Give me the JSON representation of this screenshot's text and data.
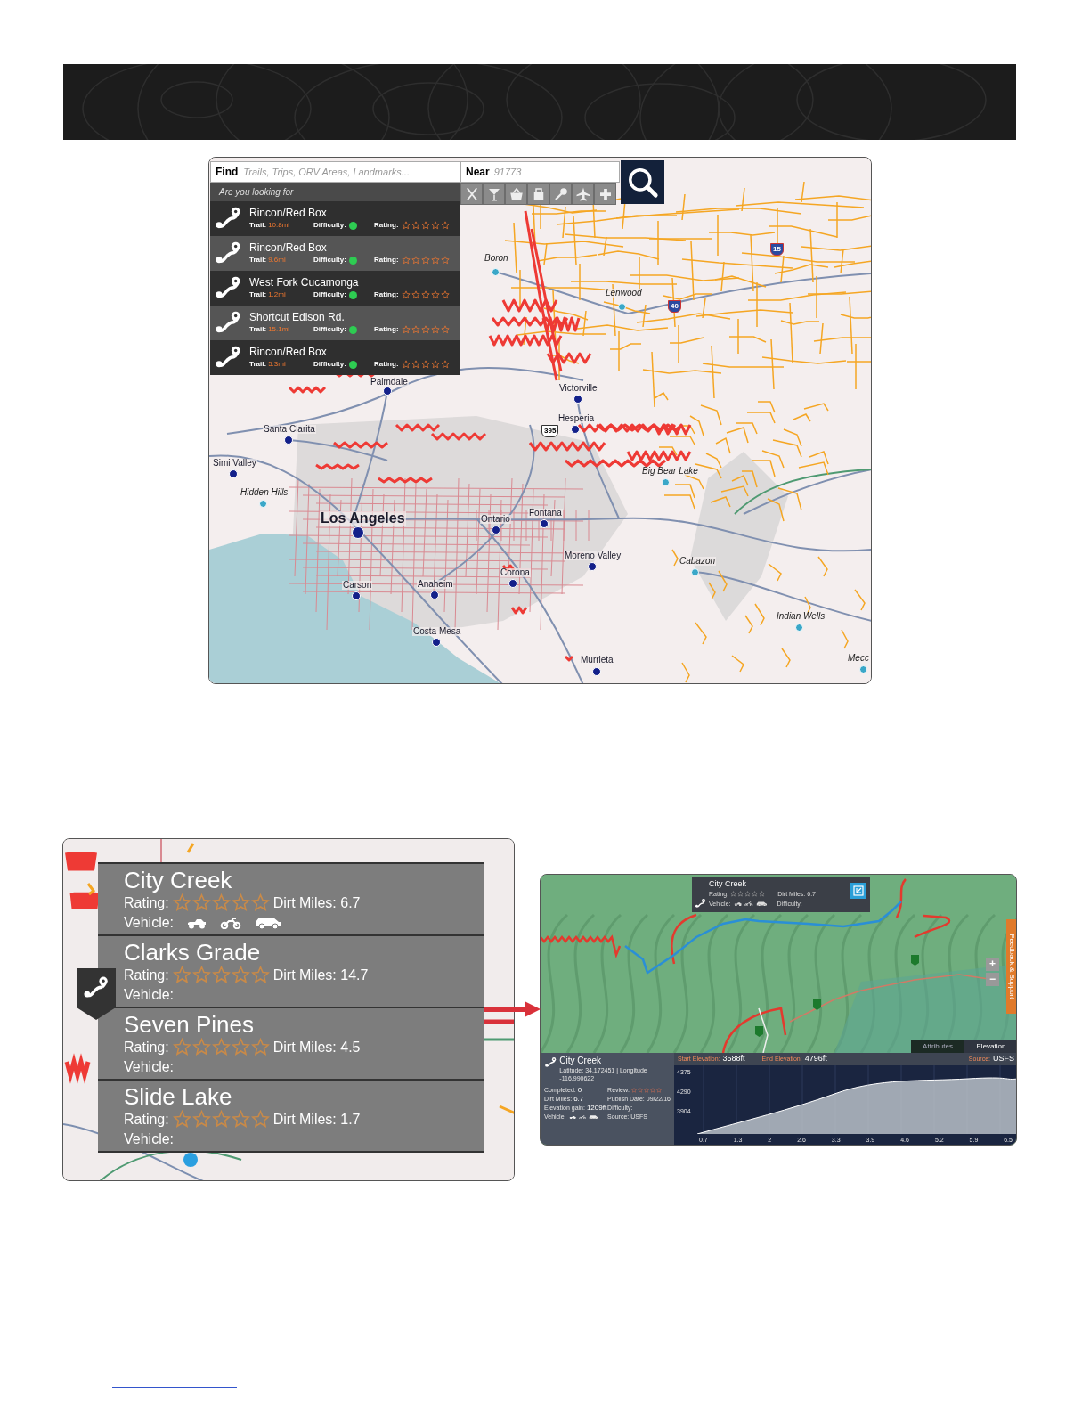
{
  "map_search": {
    "find": {
      "label": "Find",
      "placeholder": "Trails, Trips, ORV Areas, Landmarks..."
    },
    "near": {
      "label": "Near",
      "placeholder": "91773"
    },
    "suggestions": {
      "heading": "Are you looking for",
      "items": [
        {
          "name": "Rincon/Red Box",
          "trail_label": "Trail:",
          "length": "10.8mi",
          "difficulty_label": "Difficulty:",
          "color": "#2ecc52",
          "rating_label": "Rating:",
          "stars": 0
        },
        {
          "name": "Rincon/Red Box",
          "trail_label": "Trail:",
          "length": "9.6mi",
          "difficulty_label": "Difficulty:",
          "color": "#2ecc52",
          "rating_label": "Rating:",
          "stars": 0
        },
        {
          "name": "West Fork Cucamonga",
          "trail_label": "Trail:",
          "length": "1.2mi",
          "difficulty_label": "Difficulty:",
          "color": "#2ecc52",
          "rating_label": "Rating:",
          "stars": 0
        },
        {
          "name": "Shortcut Edison Rd.",
          "trail_label": "Trail:",
          "length": "15.1mi",
          "difficulty_label": "Difficulty:",
          "color": "#2ecc52",
          "rating_label": "Rating:",
          "stars": 0
        },
        {
          "name": "Rincon/Red Box",
          "trail_label": "Trail:",
          "length": "5.3mi",
          "difficulty_label": "Difficulty:",
          "color": "#2ecc52",
          "rating_label": "Rating:",
          "stars": 0
        }
      ]
    }
  },
  "map": {
    "places": [
      {
        "name": "Boron",
        "kind": "town"
      },
      {
        "name": "Lenwood",
        "kind": "town"
      },
      {
        "name": "Palmdale",
        "kind": "city"
      },
      {
        "name": "Victorville",
        "kind": "city"
      },
      {
        "name": "Hesperia",
        "kind": "city"
      },
      {
        "name": "Santa Clarita",
        "kind": "city"
      },
      {
        "name": "Simi Valley",
        "kind": "city"
      },
      {
        "name": "Big Bear Lake",
        "kind": "town"
      },
      {
        "name": "Hidden Hills",
        "kind": "town"
      },
      {
        "name": "Los Angeles",
        "kind": "major"
      },
      {
        "name": "Ontario",
        "kind": "city"
      },
      {
        "name": "Fontana",
        "kind": "city"
      },
      {
        "name": "Moreno Valley",
        "kind": "city"
      },
      {
        "name": "Cabazon",
        "kind": "town"
      },
      {
        "name": "Corona",
        "kind": "city"
      },
      {
        "name": "Carson",
        "kind": "city"
      },
      {
        "name": "Anaheim",
        "kind": "city"
      },
      {
        "name": "Indian Wells",
        "kind": "town"
      },
      {
        "name": "Costa Mesa",
        "kind": "city"
      },
      {
        "name": "Murrieta",
        "kind": "city"
      },
      {
        "name": "Mecc",
        "kind": "town"
      }
    ],
    "highway_shields": [
      {
        "number": "15",
        "kind": "interstate"
      },
      {
        "number": "40",
        "kind": "interstate"
      },
      {
        "number": "395",
        "kind": "us"
      }
    ]
  },
  "trail_list": {
    "items": [
      {
        "name": "City Creek",
        "rating_label": "Rating:",
        "stars": 0,
        "dirt_miles": "Dirt Miles: 6.7",
        "vehicle_label": "Vehicle:",
        "vehicles": [
          {
            "kind": "atv"
          },
          {
            "kind": "motorcycle"
          },
          {
            "kind": "suv"
          }
        ]
      },
      {
        "name": "Clarks Grade",
        "rating_label": "Rating:",
        "stars": 0,
        "dirt_miles": "Dirt Miles: 14.7",
        "vehicle_label": "Vehicle:"
      },
      {
        "name": "Seven Pines",
        "rating_label": "Rating:",
        "stars": 0,
        "dirt_miles": "Dirt Miles: 4.5",
        "vehicle_label": "Vehicle:"
      },
      {
        "name": "Slide Lake",
        "rating_label": "Rating:",
        "stars": 0,
        "dirt_miles": "Dirt Miles: 1.7",
        "vehicle_label": "Vehicle:"
      }
    ]
  },
  "trail_detail": {
    "popup": {
      "name": "City Creek",
      "rating_label": "Rating:",
      "stars": 0,
      "dirt_miles": "Dirt Miles: 6.7",
      "vehicle_label": "Vehicle:",
      "vehicles": [
        {
          "kind": "atv"
        },
        {
          "kind": "motorcycle"
        },
        {
          "kind": "suv"
        }
      ],
      "difficulty_label": "Difficulty:"
    },
    "side_tab": "Feedback & Support",
    "zoom_in": "+",
    "zoom_out": "−",
    "tabs": [
      {
        "label": "Attributes",
        "selected": false
      },
      {
        "label": "Elevation",
        "selected": true
      }
    ],
    "info": {
      "name": "City Creek",
      "coordinates": "Latitude: 34.172451 | Longitude -116.990622",
      "left_fields": [
        {
          "label": "Completed:",
          "value": "0"
        },
        {
          "label": "Dirt Miles:",
          "value": "6.7"
        },
        {
          "label": "Elevation gain:",
          "value": "1209ft"
        }
      ],
      "vehicle_label": "Vehicle:",
      "vehicles": [
        {
          "kind": "atv"
        },
        {
          "kind": "motorcycle"
        },
        {
          "kind": "suv"
        }
      ],
      "review_label": "Review:",
      "stars": 0,
      "right_fields": [
        {
          "label": "Publish Date:",
          "value": "09/22/16"
        },
        {
          "label": "Difficulty:"
        },
        {
          "label": "Source:",
          "value": "USFS"
        }
      ]
    },
    "elevation": {
      "start_label": "Start Elevation:",
      "start": "3588ft",
      "end_label": "End Elevation:",
      "end": "4796ft",
      "source_label": "Source:",
      "source": "USFS",
      "y_ticks": [
        "4375",
        "4290",
        "3904"
      ],
      "x_ticks": [
        "0.7",
        "1.3",
        "2",
        "2.6",
        "3.3",
        "3.9",
        "4.6",
        "5.2",
        "5.9",
        "6.5"
      ]
    }
  }
}
